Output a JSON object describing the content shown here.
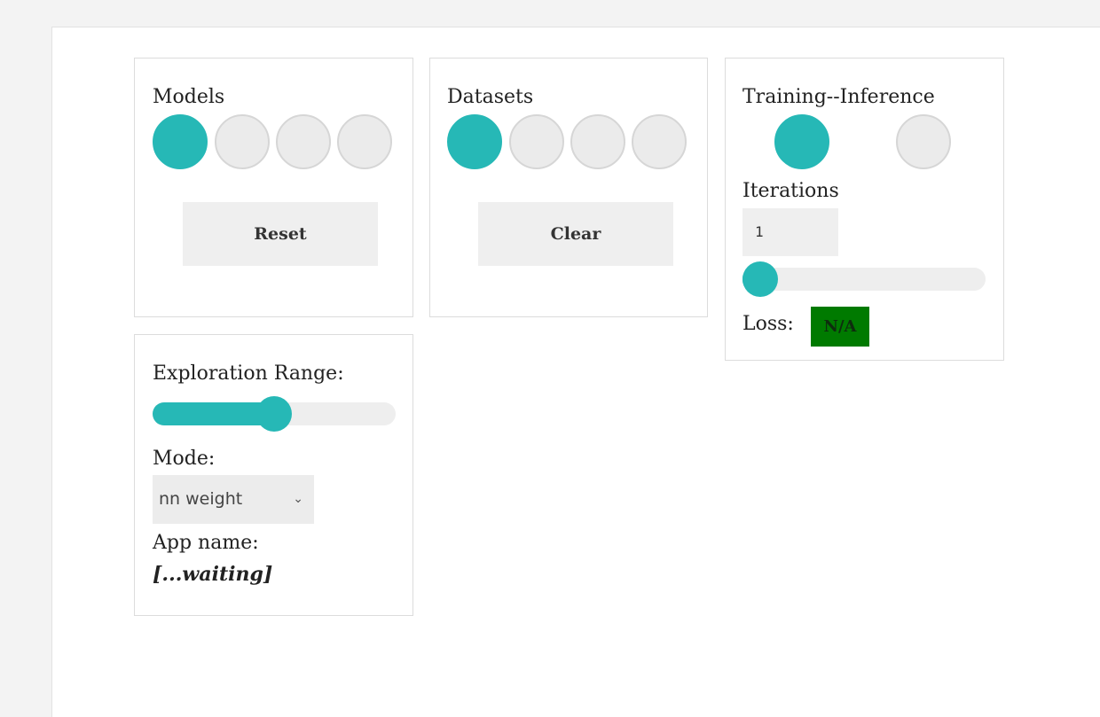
{
  "panels": {
    "models": {
      "title": "Models",
      "options": [
        {
          "selected": true
        },
        {
          "selected": false
        },
        {
          "selected": false
        },
        {
          "selected": false
        }
      ],
      "button_label": "Reset"
    },
    "datasets": {
      "title": "Datasets",
      "options": [
        {
          "selected": true
        },
        {
          "selected": false
        },
        {
          "selected": false
        },
        {
          "selected": false
        }
      ],
      "button_label": "Clear"
    },
    "training": {
      "title": "Training--Inference",
      "training_selected": true,
      "inference_selected": false,
      "iterations_label": "Iterations",
      "iterations_value": "1",
      "iterations_slider_fraction": 0.0,
      "loss_label": "Loss:",
      "loss_value": "N/A"
    },
    "exploration": {
      "range_label": "Exploration Range:",
      "range_fraction": 0.5,
      "mode_label": "Mode:",
      "mode_value": "nn weight",
      "app_name_label": "App name:",
      "app_name_value": "[...waiting]"
    }
  },
  "colors": {
    "accent": "#26b8b6",
    "loss_badge_bg": "#007a00",
    "control_bg": "#efefef"
  },
  "icons": {
    "select_chevron": "chevron-down-icon"
  }
}
